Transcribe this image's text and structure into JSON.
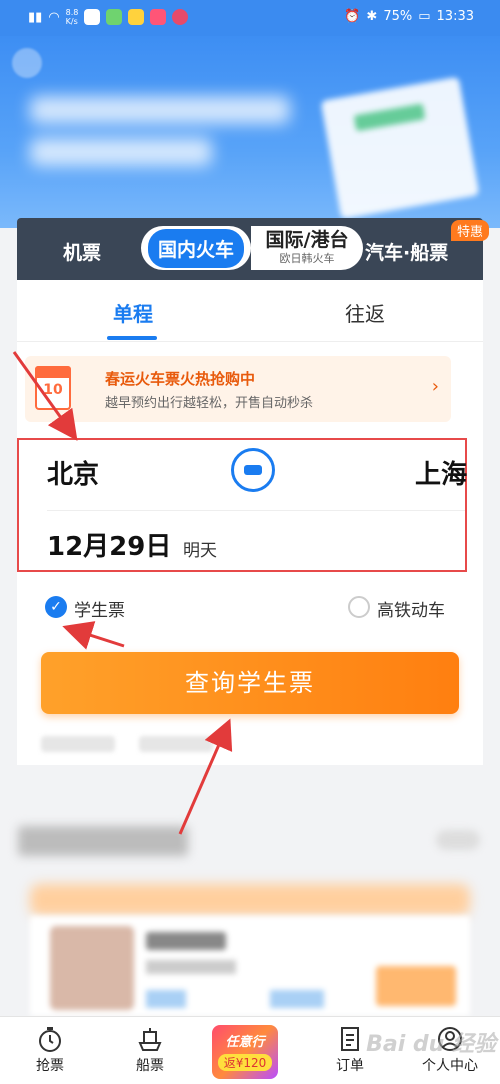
{
  "status_bar": {
    "net_top": "8.8",
    "net_bottom": "K/s",
    "battery": "75%",
    "time": "13:33"
  },
  "tabs": {
    "plane": "机票",
    "domestic_train": "国内火车",
    "intl": "国际/港台",
    "intl_sub": "欧日韩火车",
    "bus_ship": "汽车·船票",
    "badge": "特惠"
  },
  "trip_type": {
    "one_way": "单程",
    "round_trip": "往返"
  },
  "promo": {
    "calendar_number": "10",
    "title": "春运火车票火热抢购中",
    "subtitle": "越早预约出行越轻松，开售自动秒杀",
    "arrow": "›"
  },
  "route": {
    "from": "北京",
    "to": "上海",
    "date": "12月29日",
    "day": "明天"
  },
  "options": {
    "student": "学生票",
    "high_speed": "高铁动车"
  },
  "search_button": "查询学生票",
  "bottom_nav": {
    "grab": "抢票",
    "ship": "船票",
    "promo_title": "任意行",
    "promo_sub": "返¥120",
    "orders": "订单",
    "profile": "个人中心"
  },
  "watermark": "Bai du 经验"
}
